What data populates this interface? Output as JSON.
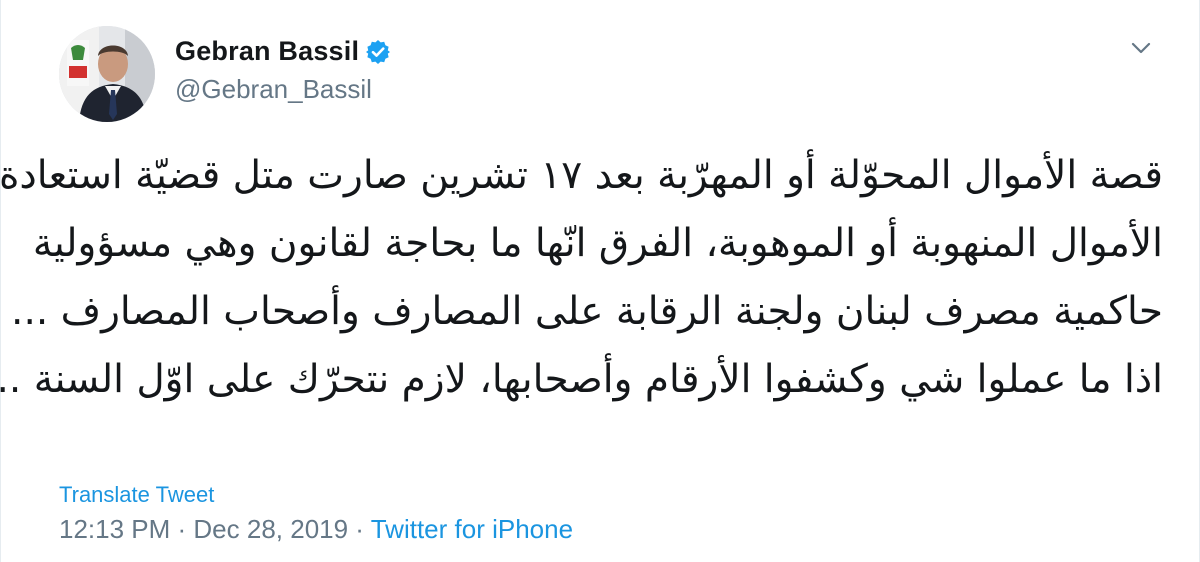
{
  "user": {
    "display_name": "Gebran Bassil",
    "handle": "@Gebran_Bassil",
    "verified": true,
    "avatar_icon": "profile-avatar"
  },
  "menu": {
    "icon": "chevron-down-icon"
  },
  "tweet": {
    "lines": [
      "قصة الأموال المحوّلة أو المهرّبة بعد ١٧ تشرين صارت متل قضيّة استعادة",
      "الأموال المنهوبة أو الموهوبة، الفرق انّها ما بحاجة لقانون وهي مسؤولية",
      "حاكمية مصرف لبنان ولجنة الرقابة على المصارف وأصحاب المصارف ...",
      "اذا ما عملوا شي وكشفوا الأرقام وأصحابها، لازم نتحرّك على اوّل السنة ..."
    ],
    "translate_label": "Translate Tweet",
    "time": "12:13 PM",
    "separator": " · ",
    "date": "Dec 28, 2019",
    "source": "Twitter for iPhone"
  },
  "colors": {
    "link": "#1b95e0",
    "muted": "#657786",
    "text": "#14171a",
    "verified": "#1da1f2"
  }
}
